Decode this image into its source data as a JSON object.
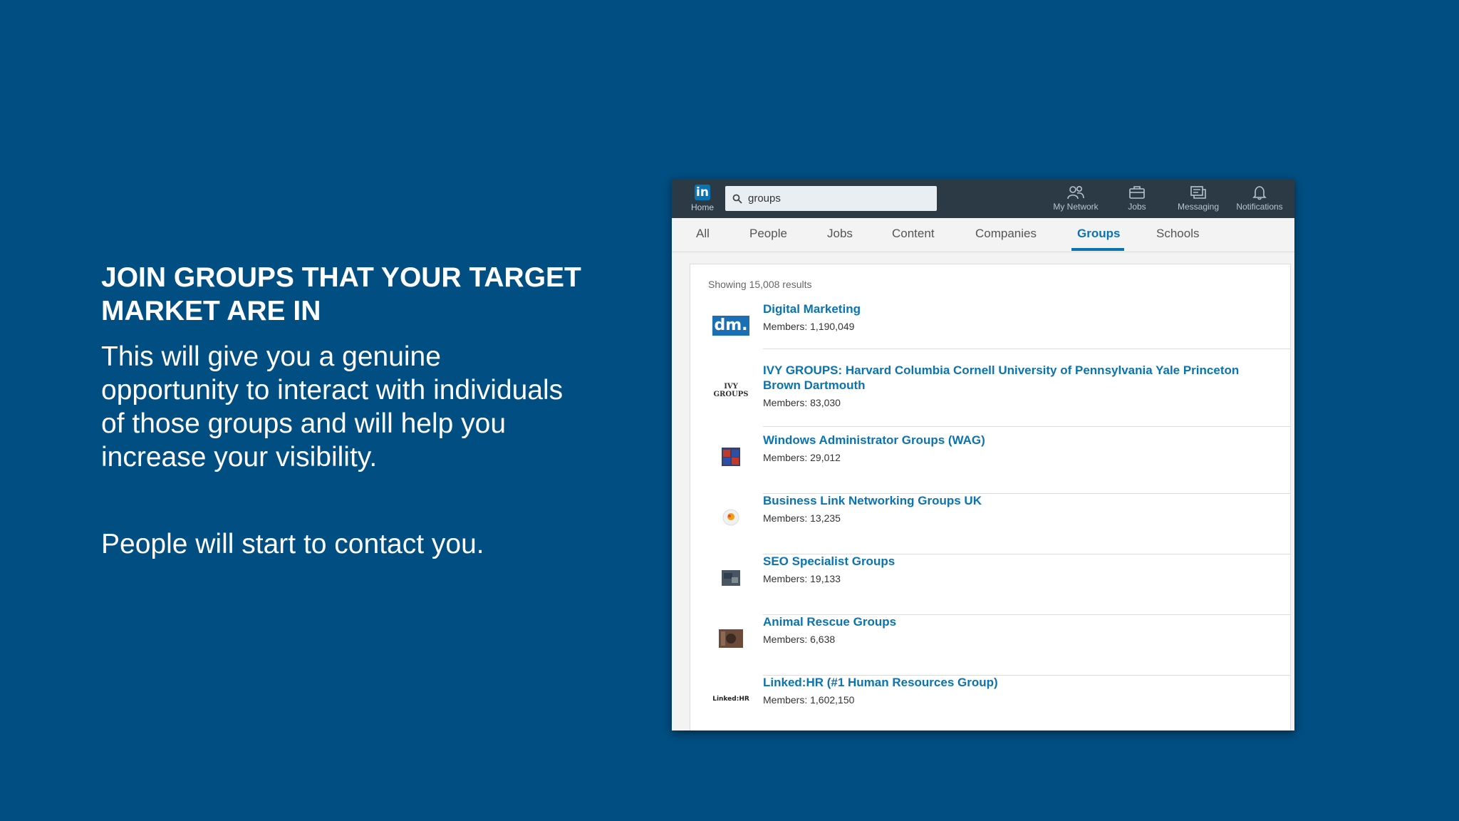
{
  "slide": {
    "heading": "JOIN GROUPS THAT YOUR TARGET MARKET ARE IN",
    "body": "This will give you a genuine opportunity to interact with individuals of those groups and will help you increase your visibility.",
    "body2": "People will start to contact you."
  },
  "topbar": {
    "home_label": "Home",
    "logo_text": "in",
    "search_value": "groups",
    "nav": [
      {
        "label": "My Network",
        "icon": "my-network-icon"
      },
      {
        "label": "Jobs",
        "icon": "briefcase-icon"
      },
      {
        "label": "Messaging",
        "icon": "messaging-icon"
      },
      {
        "label": "Notifications",
        "icon": "bell-icon"
      }
    ]
  },
  "tabs": [
    "All",
    "People",
    "Jobs",
    "Content",
    "Companies",
    "Groups",
    "Schools"
  ],
  "active_tab": "Groups",
  "results": {
    "count_text": "Showing 15,008 results",
    "groups": [
      {
        "name": "Digital Marketing",
        "members": "Members: 1,190,049",
        "logo_text": "dm."
      },
      {
        "name": "IVY GROUPS: Harvard Columbia Cornell University of Pennsylvania Yale Princeton Brown Dartmouth",
        "members": "Members: 83,030",
        "logo_text": "IVY GROUPS"
      },
      {
        "name": "Windows Administrator Groups (WAG)",
        "members": "Members: 29,012",
        "logo_text": ""
      },
      {
        "name": "Business Link Networking Groups UK",
        "members": "Members: 13,235",
        "logo_text": ""
      },
      {
        "name": "SEO Specialist Groups",
        "members": "Members: 19,133",
        "logo_text": ""
      },
      {
        "name": "Animal Rescue Groups",
        "members": "Members: 6,638",
        "logo_text": ""
      },
      {
        "name": "Linked:HR (#1 Human Resources Group)",
        "members": "Members: 1,602,150",
        "logo_text": "Linked:HR"
      }
    ]
  },
  "colors": {
    "background": "#004e82",
    "topbar": "#2b3a45",
    "link": "#0a73b1"
  }
}
